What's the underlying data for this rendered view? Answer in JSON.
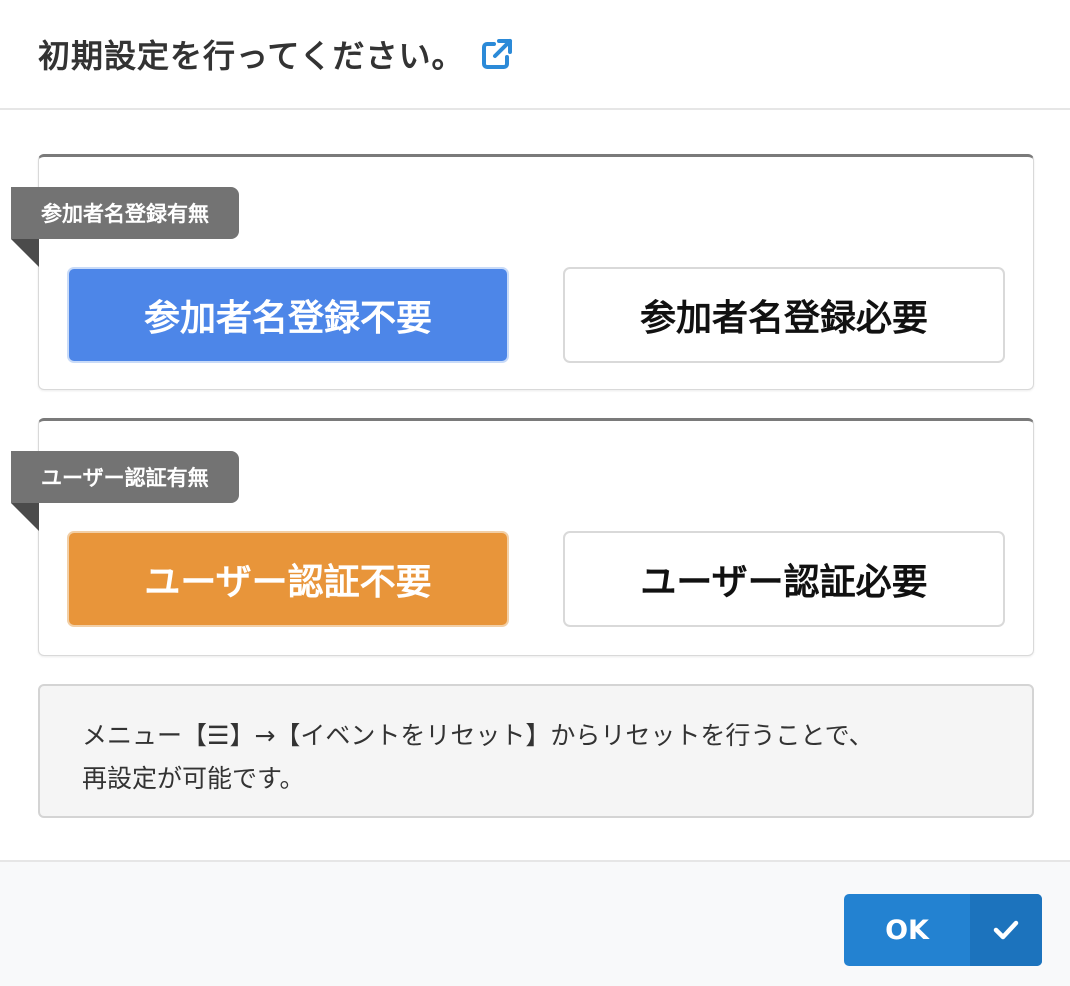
{
  "header": {
    "title": "初期設定を行ってください。",
    "link_icon": "external-link-icon",
    "link_color": "#2b8ad8"
  },
  "sections": [
    {
      "label": "参加者名登録有無",
      "options": [
        {
          "label": "参加者名登録不要",
          "selected": true,
          "color": "#4d86e8"
        },
        {
          "label": "参加者名登録必要",
          "selected": false
        }
      ]
    },
    {
      "label": "ユーザー認証有無",
      "options": [
        {
          "label": "ユーザー認証不要",
          "selected": true,
          "color": "#e8953a"
        },
        {
          "label": "ユーザー認証必要",
          "selected": false
        }
      ]
    }
  ],
  "note": {
    "line1_prefix": "メニュー【",
    "menu_icon_glyph": "☰",
    "line1_suffix": "】→【イベントをリセット】からリセットを行うことで、",
    "line2": "再設定が可能です。"
  },
  "footer": {
    "ok_label": "OK",
    "ok_icon": "check-icon",
    "ok_color": "#2382d1"
  }
}
